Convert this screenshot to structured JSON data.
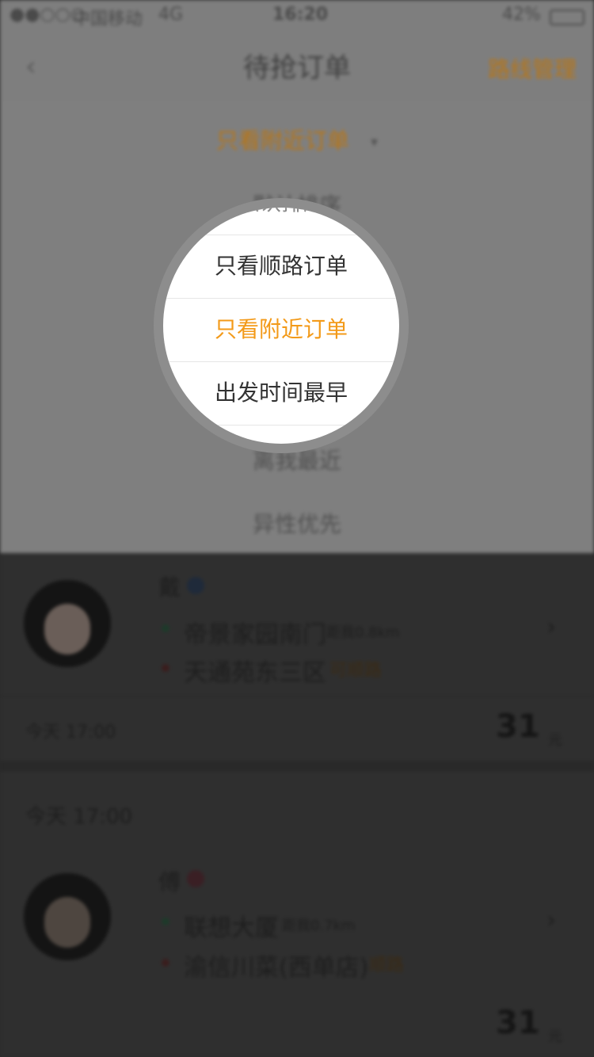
{
  "status_bar": {
    "signal": "●●○○○",
    "carrier": "中国移动",
    "network": "4G",
    "time": "16:20",
    "battery": "42%"
  },
  "nav": {
    "back_icon": "chevron-left-icon",
    "title": "待抢订单",
    "right_action": "路线管理"
  },
  "filter": {
    "current": "只看附近订单",
    "caret": "▾",
    "options": [
      "默认排序",
      "只看顺路订单",
      "只看附近订单",
      "出发时间最早",
      "离我最近",
      "异性优先"
    ]
  },
  "magnifier": {
    "rows": [
      "只看顺路订单",
      "只看附近订单",
      "出发时间最早"
    ],
    "selected": "只看附近订单",
    "top_partial": "默认排序"
  },
  "orders": [
    {
      "name": "戴",
      "from": "帝景家园南门",
      "from_dist": "距我0.8km",
      "to": "天通苑东三区",
      "tag": "可顺路",
      "footer_left": "今天 17:00",
      "price": "31",
      "price_unit": "元"
    },
    {
      "name": "傅",
      "from": "联想大厦",
      "from_dist": "距我0.7km",
      "to": "渝信川菜(西单店)",
      "tag": "顺路",
      "price": "31",
      "price_unit": "元"
    }
  ],
  "colors": {
    "accent": "#f39a19",
    "dim_accent": "#b97513",
    "overlay_top": "#7f7f7f",
    "overlay_bottom": "#2f2f2f"
  }
}
